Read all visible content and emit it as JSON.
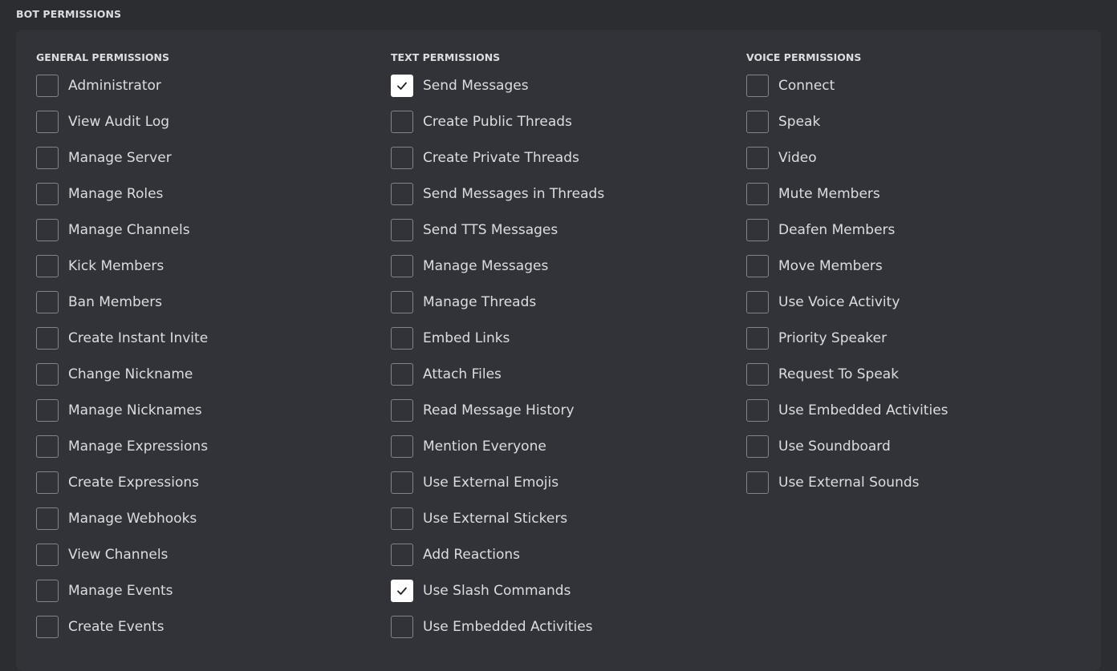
{
  "page": {
    "heading": "BOT PERMISSIONS"
  },
  "columns": [
    {
      "id": "general",
      "heading": "GENERAL PERMISSIONS",
      "items": [
        {
          "label": "Administrator",
          "checked": false
        },
        {
          "label": "View Audit Log",
          "checked": false
        },
        {
          "label": "Manage Server",
          "checked": false
        },
        {
          "label": "Manage Roles",
          "checked": false
        },
        {
          "label": "Manage Channels",
          "checked": false
        },
        {
          "label": "Kick Members",
          "checked": false
        },
        {
          "label": "Ban Members",
          "checked": false
        },
        {
          "label": "Create Instant Invite",
          "checked": false
        },
        {
          "label": "Change Nickname",
          "checked": false
        },
        {
          "label": "Manage Nicknames",
          "checked": false
        },
        {
          "label": "Manage Expressions",
          "checked": false
        },
        {
          "label": "Create Expressions",
          "checked": false
        },
        {
          "label": "Manage Webhooks",
          "checked": false
        },
        {
          "label": "View Channels",
          "checked": false
        },
        {
          "label": "Manage Events",
          "checked": false
        },
        {
          "label": "Create Events",
          "checked": false
        }
      ]
    },
    {
      "id": "text",
      "heading": "TEXT PERMISSIONS",
      "items": [
        {
          "label": "Send Messages",
          "checked": true
        },
        {
          "label": "Create Public Threads",
          "checked": false
        },
        {
          "label": "Create Private Threads",
          "checked": false
        },
        {
          "label": "Send Messages in Threads",
          "checked": false
        },
        {
          "label": "Send TTS Messages",
          "checked": false
        },
        {
          "label": "Manage Messages",
          "checked": false
        },
        {
          "label": "Manage Threads",
          "checked": false
        },
        {
          "label": "Embed Links",
          "checked": false
        },
        {
          "label": "Attach Files",
          "checked": false
        },
        {
          "label": "Read Message History",
          "checked": false
        },
        {
          "label": "Mention Everyone",
          "checked": false
        },
        {
          "label": "Use External Emojis",
          "checked": false
        },
        {
          "label": "Use External Stickers",
          "checked": false
        },
        {
          "label": "Add Reactions",
          "checked": false
        },
        {
          "label": "Use Slash Commands",
          "checked": true
        },
        {
          "label": "Use Embedded Activities",
          "checked": false
        }
      ]
    },
    {
      "id": "voice",
      "heading": "VOICE PERMISSIONS",
      "items": [
        {
          "label": "Connect",
          "checked": false
        },
        {
          "label": "Speak",
          "checked": false
        },
        {
          "label": "Video",
          "checked": false
        },
        {
          "label": "Mute Members",
          "checked": false
        },
        {
          "label": "Deafen Members",
          "checked": false
        },
        {
          "label": "Move Members",
          "checked": false
        },
        {
          "label": "Use Voice Activity",
          "checked": false
        },
        {
          "label": "Priority Speaker",
          "checked": false
        },
        {
          "label": "Request To Speak",
          "checked": false
        },
        {
          "label": "Use Embedded Activities",
          "checked": false
        },
        {
          "label": "Use Soundboard",
          "checked": false
        },
        {
          "label": "Use External Sounds",
          "checked": false
        }
      ]
    }
  ],
  "icons": {
    "check": "check-icon"
  },
  "colors": {
    "page_bg": "#2b2d31",
    "panel_bg": "#313338",
    "text": "#dbdee1",
    "checkbox_border": "#80848e",
    "checkbox_checked_bg": "#ffffff"
  }
}
